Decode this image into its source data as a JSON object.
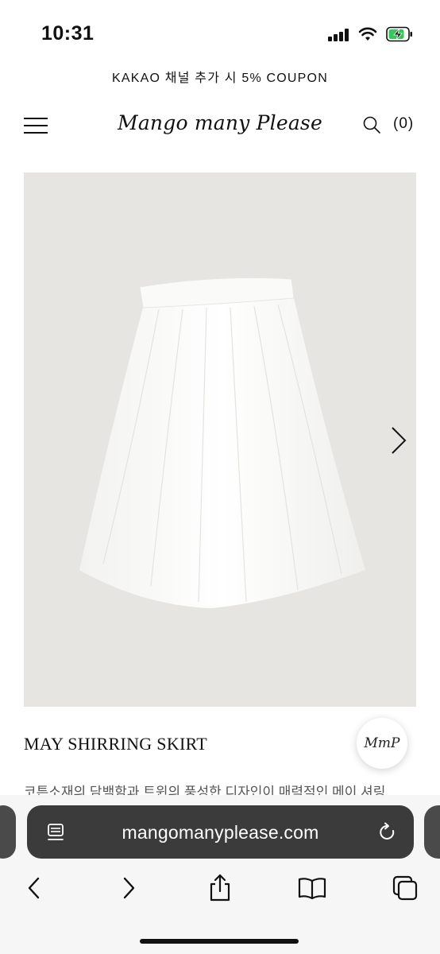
{
  "status_bar": {
    "time": "10:31",
    "icons": [
      "signal-icon",
      "wifi-icon",
      "battery-charging-icon"
    ]
  },
  "announcement": "KAKAO 채널 추가 시 5% COUPON",
  "header": {
    "menu_icon": "hamburger-menu-icon",
    "brand": "Mango many Please",
    "search_icon": "search-icon",
    "cart_count": "(0)"
  },
  "gallery": {
    "next_icon": "chevron-right-icon",
    "background_color": "#e7e5e1"
  },
  "product": {
    "title": "MAY SHIRRING SKIRT",
    "description": "코튼소재의 담백함과 트윈의 풍성한 디자인이 매력적인 메이 셔링",
    "badge": "MmP"
  },
  "browser": {
    "url": "mangomanyplease.com",
    "reader_icon": "page-menu-icon",
    "reload_icon": "reload-icon",
    "toolbar": [
      "back-icon",
      "forward-icon",
      "share-icon",
      "bookmarks-icon",
      "tabs-icon"
    ]
  },
  "colors": {
    "text": "#111111",
    "url_bar": "#3b3b3b",
    "image_bg": "#e7e5e1"
  }
}
